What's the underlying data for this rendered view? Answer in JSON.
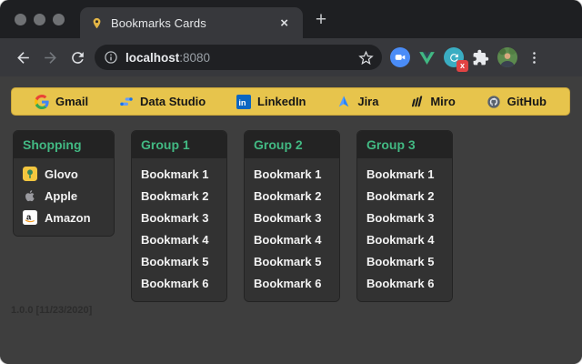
{
  "window": {
    "tab_title": "Bookmarks Cards",
    "close_tab_label": "×",
    "new_tab_label": "+",
    "url": {
      "host": "localhost",
      "port": ":8080"
    }
  },
  "bookmarks_bar": {
    "bg_color": "#e7c44c",
    "items": [
      {
        "label": "Gmail"
      },
      {
        "label": "Data Studio"
      },
      {
        "label": "LinkedIn"
      },
      {
        "label": "Jira"
      },
      {
        "label": "Miro"
      },
      {
        "label": "GitHub"
      }
    ]
  },
  "cards": [
    {
      "title": "Shopping",
      "items": [
        {
          "label": "Glovo"
        },
        {
          "label": "Apple"
        },
        {
          "label": "Amazon"
        }
      ]
    },
    {
      "title": "Group 1",
      "items": [
        "Bookmark 1",
        "Bookmark 2",
        "Bookmark 3",
        "Bookmark 4",
        "Bookmark 5",
        "Bookmark 6"
      ]
    },
    {
      "title": "Group 2",
      "items": [
        "Bookmark 1",
        "Bookmark 2",
        "Bookmark 3",
        "Bookmark 4",
        "Bookmark 5",
        "Bookmark 6"
      ]
    },
    {
      "title": "Group 3",
      "items": [
        "Bookmark 1",
        "Bookmark 2",
        "Bookmark 3",
        "Bookmark 4",
        "Bookmark 5",
        "Bookmark 6"
      ]
    }
  ],
  "footer": {
    "version": "1.0.0 [11/23/2020]"
  },
  "colors": {
    "accent_green": "#42b983",
    "bookmarks_bar": "#e7c44c",
    "page_bg": "#3e3e3e"
  }
}
